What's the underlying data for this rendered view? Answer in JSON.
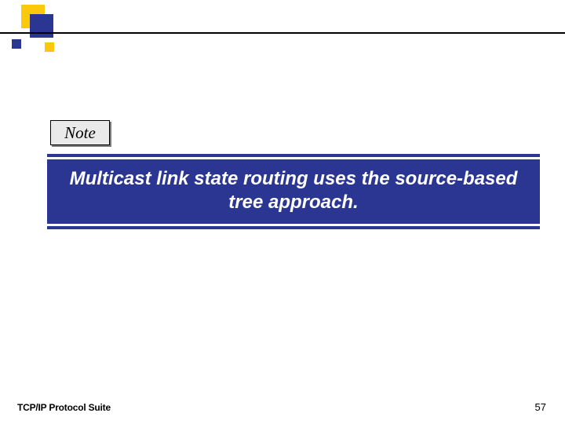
{
  "note": {
    "label": "Note",
    "text": "Multicast link state routing uses the source-based tree approach."
  },
  "footer": {
    "left": "TCP/IP Protocol Suite",
    "page": "57"
  }
}
